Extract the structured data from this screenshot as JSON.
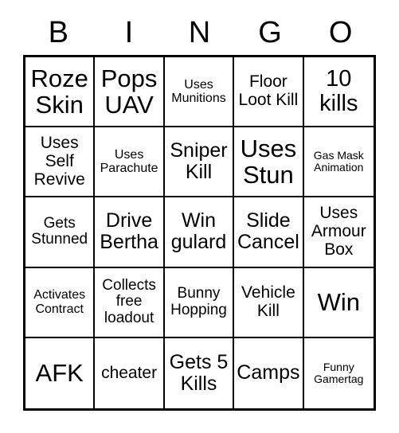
{
  "card": {
    "title": "Bingo Card",
    "header_letters": [
      "B",
      "I",
      "N",
      "G",
      "O"
    ],
    "colors": {
      "background": "#ffffff",
      "text": "#000000",
      "border": "#000000"
    },
    "rows": [
      [
        {
          "text": "Roze Skin",
          "size": "xl"
        },
        {
          "text": "Pops UAV",
          "size": "xl"
        },
        {
          "text": "Uses Munitions",
          "size": "xxs"
        },
        {
          "text": "Floor Loot Kill",
          "size": "sm"
        },
        {
          "text": "10 kills",
          "size": "lg"
        }
      ],
      [
        {
          "text": "Uses Self Revive",
          "size": "sm"
        },
        {
          "text": "Uses Parachute",
          "size": "xxs"
        },
        {
          "text": "Sniper Kill",
          "size": "md"
        },
        {
          "text": "Uses Stun",
          "size": "xl"
        },
        {
          "text": "Gas Mask Animation",
          "size": "tiny"
        }
      ],
      [
        {
          "text": "Gets Stunned",
          "size": "xs"
        },
        {
          "text": "Drive Bertha",
          "size": "md"
        },
        {
          "text": "Win gulard",
          "size": "md"
        },
        {
          "text": "Slide Cancel",
          "size": "md"
        },
        {
          "text": "Uses Armour Box",
          "size": "sm"
        }
      ],
      [
        {
          "text": "Activates Contract",
          "size": "xxs"
        },
        {
          "text": "Collects free loadout",
          "size": "xs"
        },
        {
          "text": "Bunny Hopping",
          "size": "xs"
        },
        {
          "text": "Vehicle Kill",
          "size": "sm"
        },
        {
          "text": "Win",
          "size": "xl"
        }
      ],
      [
        {
          "text": "AFK",
          "size": "xl"
        },
        {
          "text": "cheater",
          "size": "sm"
        },
        {
          "text": "Gets 5 Kills",
          "size": "md"
        },
        {
          "text": "Camps",
          "size": "md"
        },
        {
          "text": "Funny Gamertag",
          "size": "tiny"
        }
      ]
    ]
  }
}
